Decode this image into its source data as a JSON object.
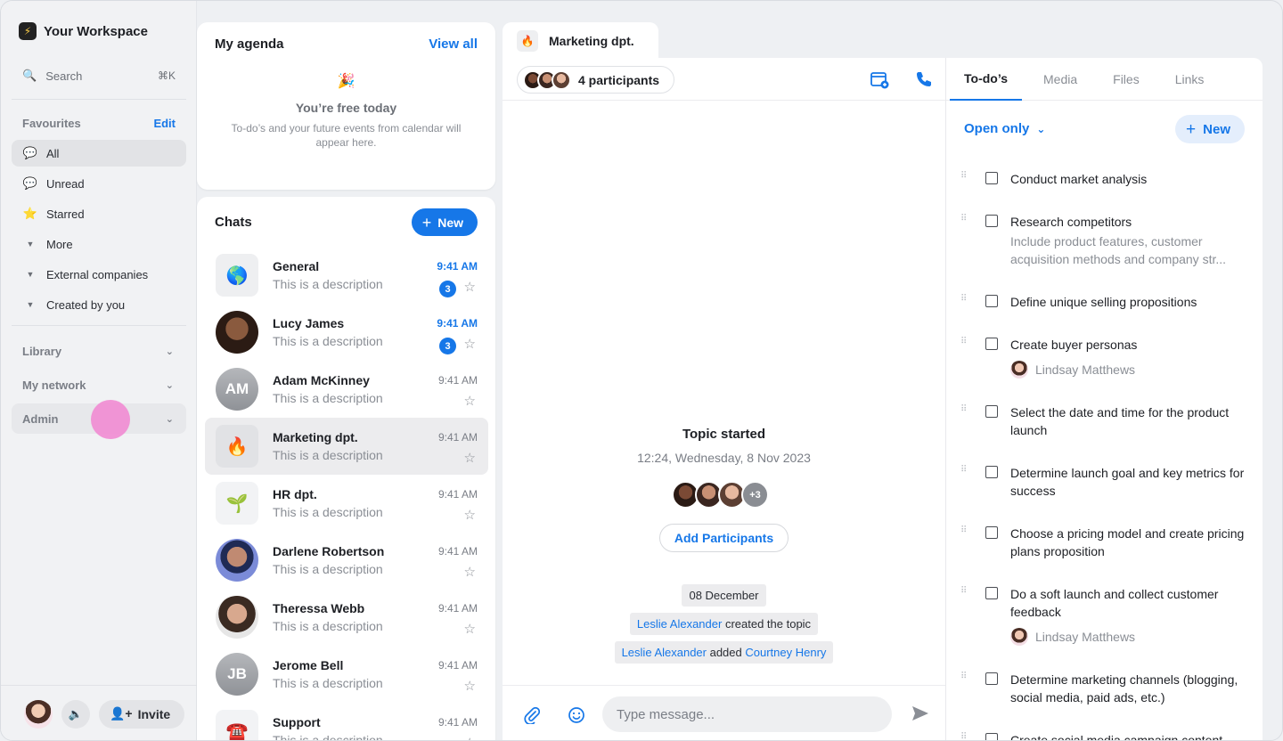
{
  "workspace": {
    "title": "Your Workspace",
    "logo_glyph": "⚡"
  },
  "search": {
    "label": "Search",
    "shortcut": "⌘K"
  },
  "favourites": {
    "heading": "Favourites",
    "edit_label": "Edit",
    "items": [
      {
        "label": "All",
        "icon": "chat-bubble-icon"
      },
      {
        "label": "Unread",
        "icon": "chat-bubble-unread-icon"
      },
      {
        "label": "Starred",
        "icon": "star-icon"
      },
      {
        "label": "More",
        "icon": "caret-down-icon"
      },
      {
        "label": "External companies",
        "icon": "caret-down-icon"
      },
      {
        "label": "Created by you",
        "icon": "caret-down-icon"
      }
    ]
  },
  "groups": [
    {
      "label": "Library"
    },
    {
      "label": "My network"
    },
    {
      "label": "Admin"
    }
  ],
  "bottom": {
    "invite_label": "Invite"
  },
  "agenda": {
    "title": "My agenda",
    "view_all": "View all",
    "emoji": "🎉",
    "free_title": "You’re free today",
    "free_desc": "To-do’s and your future events from calendar will appear here."
  },
  "chats": {
    "title": "Chats",
    "new_label": "New",
    "items": [
      {
        "name": "General",
        "desc": "This is a description",
        "time": "9:41 AM",
        "unread": "3",
        "avatar": "🌎"
      },
      {
        "name": "Lucy James",
        "desc": "This is a description",
        "time": "9:41 AM",
        "unread": "3"
      },
      {
        "name": "Adam McKinney",
        "desc": "This is a description",
        "time": "9:41 AM",
        "initials": "AM"
      },
      {
        "name": "Marketing dpt.",
        "desc": "This is a description",
        "time": "9:41 AM",
        "avatar": "🔥"
      },
      {
        "name": "HR dpt.",
        "desc": "This is a description",
        "time": "9:41 AM",
        "avatar": "🌱"
      },
      {
        "name": "Darlene Robertson",
        "desc": "This is a description",
        "time": "9:41 AM"
      },
      {
        "name": "Theressa Webb",
        "desc": "This is a description",
        "time": "9:41 AM"
      },
      {
        "name": "Jerome Bell",
        "desc": "This is a description",
        "time": "9:41 AM",
        "initials": "JB"
      },
      {
        "name": "Support",
        "desc": "This is a description",
        "time": "9:41 AM",
        "avatar": "☎️"
      }
    ]
  },
  "conversation": {
    "tab_title": "Marketing dpt.",
    "tab_icon": "🔥",
    "participants_label": "4 participants",
    "topic_title": "Topic started",
    "topic_date": "12:24, Wednesday, 8 Nov 2023",
    "more_count": "+3",
    "add_participants": "Add Participants",
    "date_chip": "08 December",
    "event1": {
      "actor": "Leslie Alexander",
      "action": " created the topic"
    },
    "event2": {
      "actor": "Leslie Alexander",
      "action": " added ",
      "target": "Courtney Henry"
    },
    "input_placeholder": "Type message..."
  },
  "right_panel": {
    "tabs": [
      "To-do’s",
      "Media",
      "Files",
      "Links"
    ],
    "filter_label": "Open only",
    "new_label": "New",
    "todos": [
      {
        "title": "Conduct market analysis"
      },
      {
        "title": "Research competitors",
        "sub": "Include product features, customer acquisition methods and company str..."
      },
      {
        "title": "Define unique selling propositions"
      },
      {
        "title": "Create buyer personas",
        "assignee": "Lindsay Matthews"
      },
      {
        "title": "Select the date and time for the product launch"
      },
      {
        "title": "Determine launch goal and key metrics for success"
      },
      {
        "title": "Choose a pricing model and create pricing plans proposition"
      },
      {
        "title": "Do a soft launch and collect customer feedback",
        "assignee": "Lindsay Matthews"
      },
      {
        "title": "Determine marketing channels (blogging, social media, paid ads, etc.)"
      },
      {
        "title": "Create social media campaign content"
      }
    ]
  },
  "colors": {
    "accent": "#1677e8",
    "highlight_dot": "#f08fd4"
  }
}
